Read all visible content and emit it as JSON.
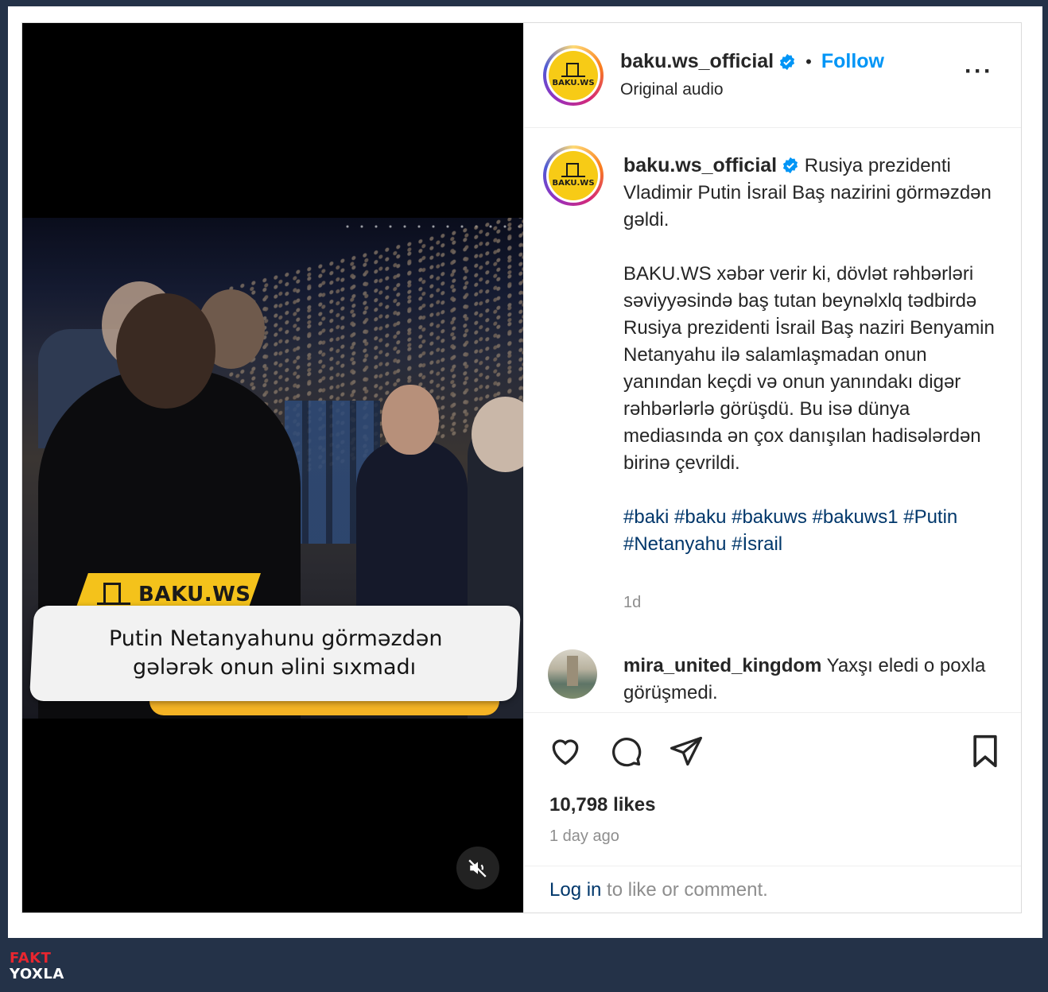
{
  "post": {
    "author": {
      "username": "baku.ws_official",
      "avatar_text": "BAKU.WS",
      "verified": true,
      "follow_label": "Follow",
      "separator": "•",
      "audio_label": "Original audio"
    },
    "media": {
      "brand_tag": "BAKU.WS",
      "caption_line1": "Putin Netanyahunu görməzdən",
      "caption_line2": "gələrək onun əlini sıxmadı",
      "mute_icon": "speaker-muted-icon"
    },
    "caption": {
      "username": "baku.ws_official",
      "paragraph1": "Rusiya prezidenti Vladimir Putin İsrail Baş nazirini görməzdən gəldi.",
      "paragraph2": "BAKU.WS xəbər verir ki, dövlət rəhbərləri səviyyəsində baş tutan beynəlxlq tədbirdə Rusiya prezidenti İsrail Baş naziri Benyamin Netanyahu ilə salamlaşmadan onun yanından keçdi və onun yanındakı digər rəhbərlərlə görüşdü. Bu isə dünya mediasında ən çox danışılan hadisələrdən birinə çevrildi.",
      "hashtags": "#baki #baku #bakuws #bakuws1 #Putin #Netanyahu #İsrail",
      "timestamp": "1d"
    },
    "comment": {
      "username": "mira_united_kingdom",
      "text": "Yaxşı eledi o poxla görüşmedi."
    },
    "actions": {
      "like_icon": "heart-icon",
      "comment_icon": "comment-bubble-icon",
      "share_icon": "paper-plane-icon",
      "save_icon": "bookmark-icon"
    },
    "likes": "10,798 likes",
    "posted_ago": "1 day ago",
    "login": {
      "link": "Log in",
      "rest": " to like or comment."
    }
  },
  "watermark": {
    "line1": "FAKT",
    "line2": "YOXLA"
  },
  "colors": {
    "background": "#243248",
    "link_blue": "#0095f6",
    "hashtag_blue": "#00376b",
    "brand_yellow": "#f4c21b",
    "watermark_red": "#e8262f"
  }
}
